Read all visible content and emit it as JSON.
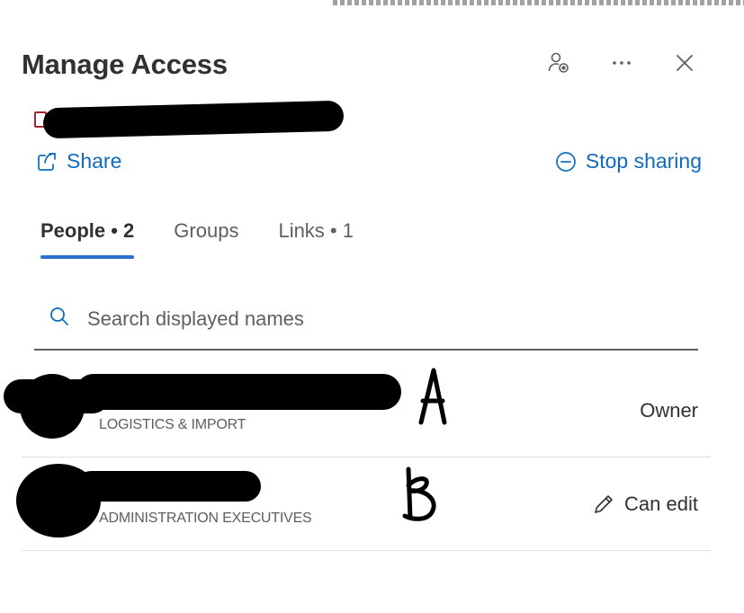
{
  "panel": {
    "title": "Manage Access",
    "share_label": "Share",
    "stop_sharing_label": "Stop sharing"
  },
  "tabs": [
    {
      "label": "People • 2",
      "active": true
    },
    {
      "label": "Groups",
      "active": false
    },
    {
      "label": "Links • 1",
      "active": false
    }
  ],
  "search": {
    "placeholder": "Search displayed names"
  },
  "people": [
    {
      "department": "LOGISTICS & IMPORT",
      "role": "Owner",
      "annotation": "A"
    },
    {
      "department": "ADMINISTRATION EXECUTIVES",
      "role": "Can edit",
      "annotation": "B"
    }
  ],
  "colors": {
    "accent": "#0f6cbd",
    "tab_underline": "#2b6fcf",
    "text": "#323130",
    "muted": "#605e5c"
  },
  "icons": [
    "person-settings-icon",
    "more-icon",
    "close-icon",
    "share-icon",
    "stop-sharing-icon",
    "search-icon",
    "pencil-icon",
    "file-icon"
  ]
}
